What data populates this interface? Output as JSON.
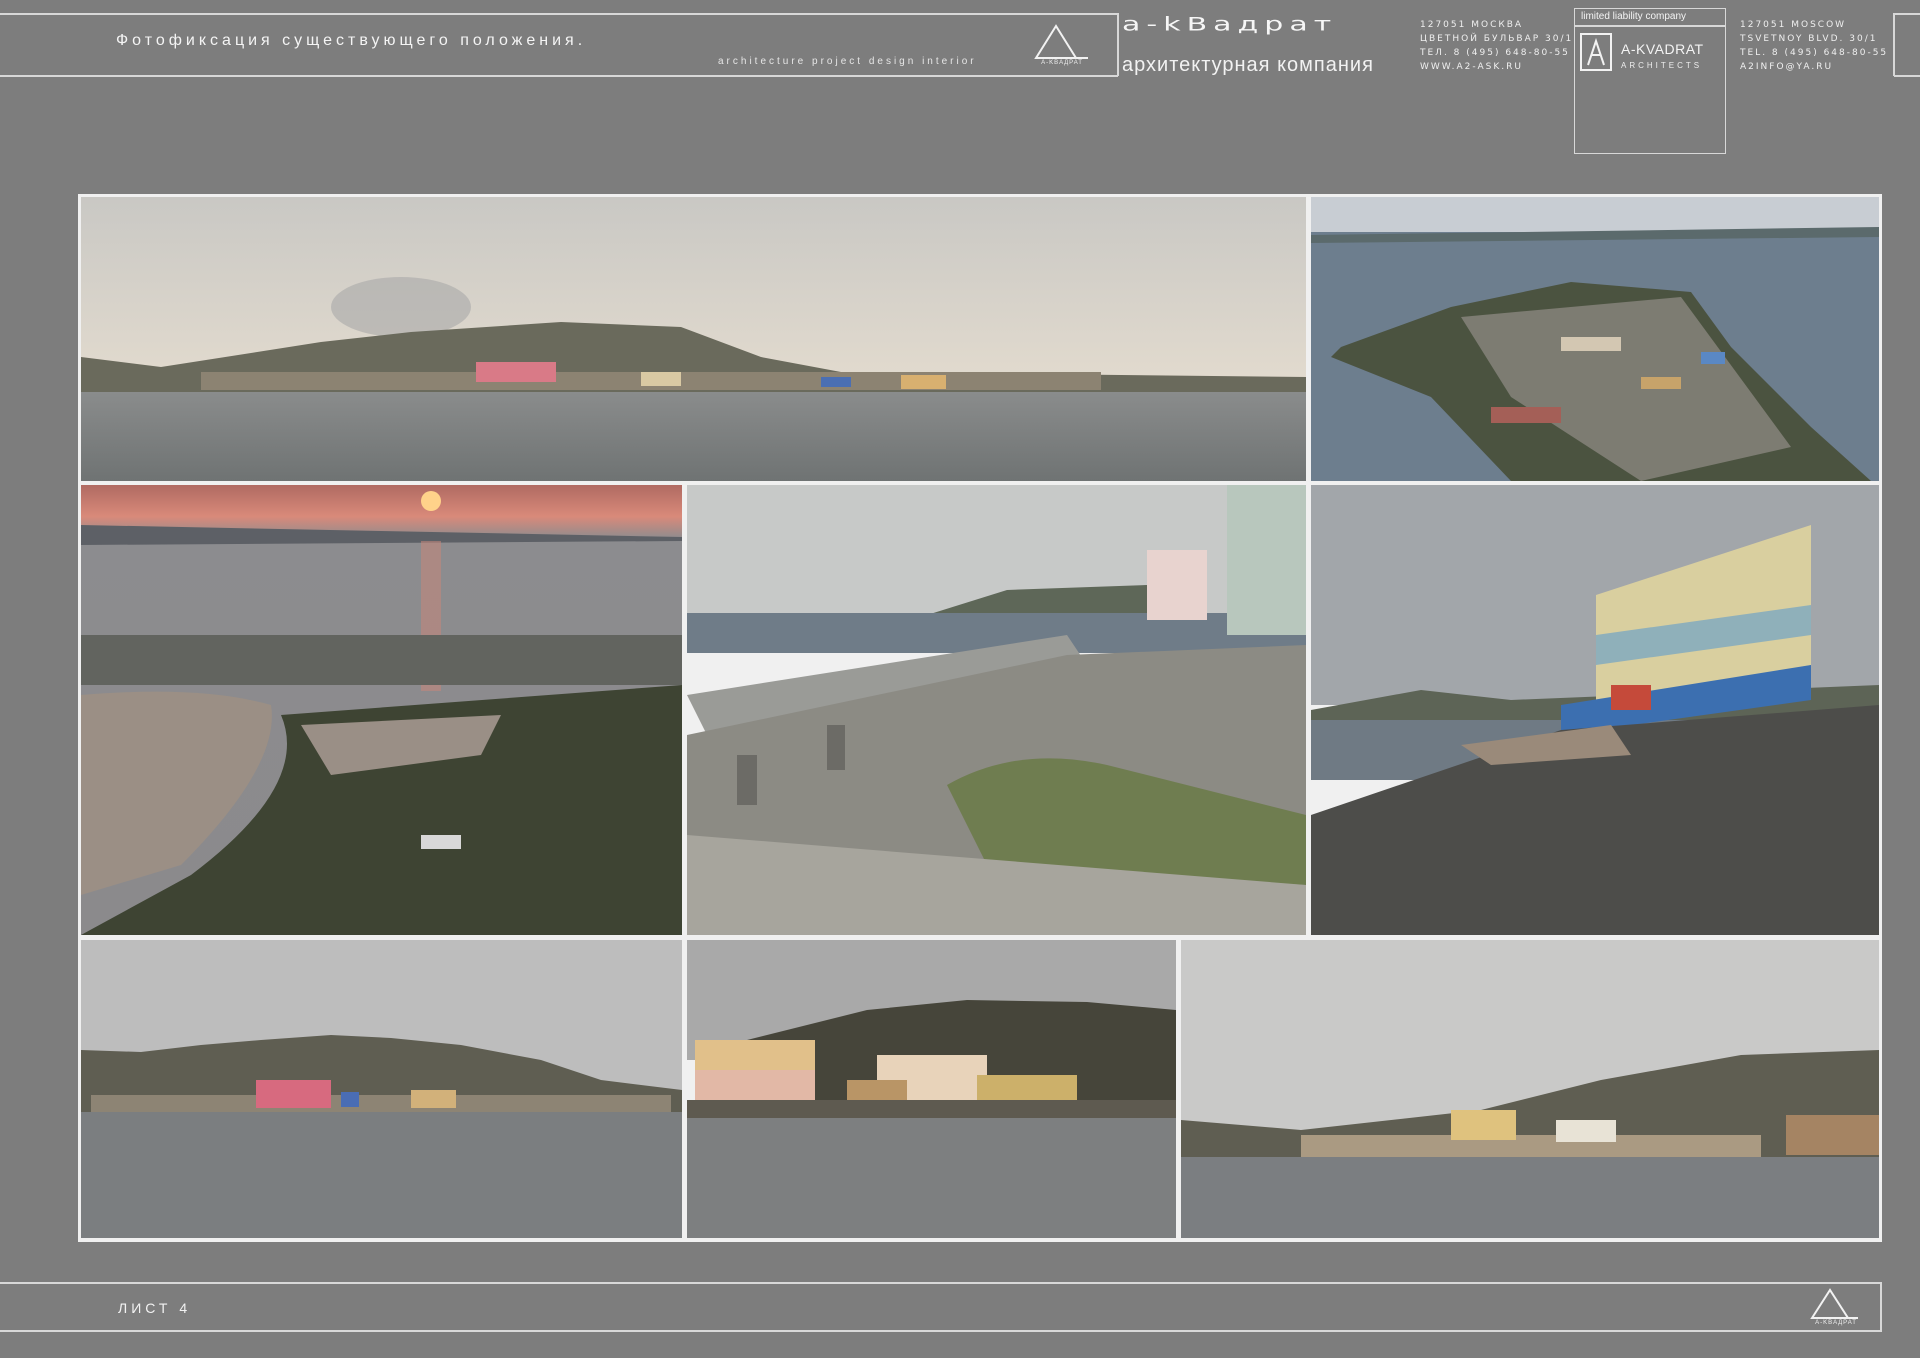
{
  "header": {
    "title": "Фотофиксация существующего положения.",
    "subtitle": "architecture  project  design  interior",
    "logo_label": "A-KBAДPAT",
    "brand": "a-kBaдpaт",
    "brand_sub": "архитектурная компания",
    "contact_ru": [
      "127051 МОСКВА",
      "ЦВЕТНОЙ БУЛЬВАР 30/1",
      "ТЕЛ. 8 (495) 648-80-55",
      "WWW.A2-ASK.RU"
    ],
    "company_type": "limited liability company",
    "company_name": "A-KVADRAT",
    "company_sub": "ARCHITECTS",
    "contact_en": [
      "127051 MOSCOW",
      "TSVETNOY BLVD. 30/1",
      "TEL. 8 (495) 648-80-55",
      "A2INFO@YA.RU"
    ]
  },
  "photos": [
    {
      "name": "photo-panorama-town-shore"
    },
    {
      "name": "photo-aerial-peninsula-town"
    },
    {
      "name": "photo-aerial-sunset-town"
    },
    {
      "name": "photo-collapsed-pier"
    },
    {
      "name": "photo-building-on-shore"
    },
    {
      "name": "photo-town-from-water-left"
    },
    {
      "name": "photo-town-from-water-center"
    },
    {
      "name": "photo-town-from-water-right"
    }
  ],
  "footer": {
    "sheet_label": "ЛИСТ 4",
    "logo_label": "A-KBAДPAT"
  }
}
